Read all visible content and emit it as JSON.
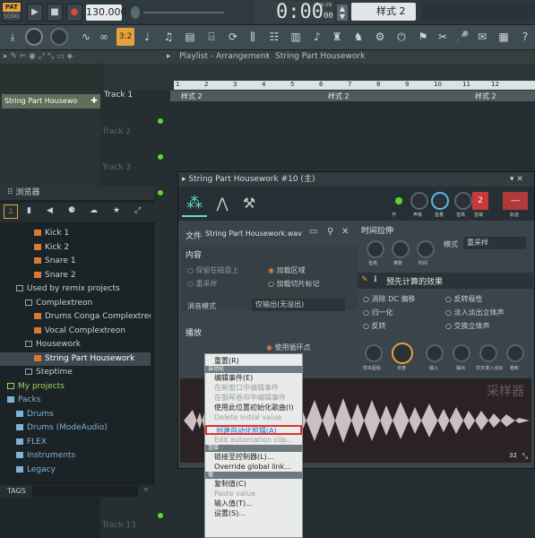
{
  "transport": {
    "pat_label": "PAT",
    "song_label": "SONG",
    "tempo": "130.000",
    "time": "0:00",
    "time_suffix": "00",
    "time_unit": "M:S:CS",
    "pattern": "样式 2"
  },
  "playlist": {
    "breadcrumb": "Playlist - Arrangement",
    "separator": "›",
    "title": "String Part Housework",
    "clip_name": "String Part Housewo",
    "tracks": [
      "Track 1",
      "Track 2",
      "Track 3",
      "Track 13"
    ],
    "ruler": [
      "1",
      "2",
      "3",
      "4",
      "5",
      "6",
      "7",
      "8",
      "9",
      "10",
      "11",
      "12"
    ],
    "pattern_blocks": [
      "样式 2",
      "样式 2",
      "样式 2",
      "样式 2"
    ]
  },
  "browser": {
    "title": "浏览器",
    "items": [
      "Kick 1",
      "Kick 2",
      "Snare 1",
      "Snare 2",
      "Used by remix projects",
      "Complextreon",
      "Drums Conga Complextreon",
      "Vocal Complextreon",
      "Housework",
      "String Part Housework",
      "Steptime",
      "My projects",
      "Packs",
      "Drums",
      "Drums (ModeAudio)",
      "FLEX",
      "Instruments",
      "Legacy"
    ],
    "tags_label": "TAGS"
  },
  "sampler": {
    "title": "String Part Housework #10 (主)",
    "file_label": "文件",
    "file_name": "String Part Housework.wav",
    "content_label": "内容",
    "opt_keep_disk": "保留在磁盘上",
    "opt_load_region": "加载区域",
    "opt_resample": "重采样",
    "opt_load_slices": "加载切片标记",
    "declick_label": "消音模式",
    "declick_value": "仅输出(无溢出)",
    "playback_label": "播放",
    "use_loop": "使用循环点",
    "stretch_label": "时间拉伸",
    "mode_label": "模式",
    "mode_value": "重采样",
    "stretch_knobs": [
      "音高",
      "乘数",
      "时间"
    ],
    "precomp_label": "预先计算的效果",
    "fx": [
      "消除 DC 偏移",
      "反转极性",
      "归一化",
      "淡入淡出立体声",
      "反转",
      "交换立体声"
    ],
    "fx_knobs": [
      "样本起始",
      "长度",
      "输入",
      "输出",
      "交叉淋入淡出",
      "卷积"
    ],
    "top_knobs": [
      "开",
      "声像",
      "音量",
      "音高",
      "音域",
      "轨道"
    ],
    "channel": "2",
    "track_btn": "---",
    "sampler_tag": "采样器",
    "counter": "32"
  },
  "menu": {
    "reset": "重置(R)",
    "sec_automate": "自动化",
    "edit_event": "编辑事件(E)",
    "edit_event_new": "在新窗口中编辑事件",
    "edit_in_piano": "在钢琴卷帘中编辑事件",
    "init_song": "使用此位置初始化歌曲(I)",
    "del_init": "Delete initial value",
    "create_clip": "创建自动化剪辑(A)",
    "edit_clip": "Edit automation clip...",
    "sec_link": "连接",
    "link_ctrl": "链接至控制器(L)...",
    "override": "Override global link...",
    "sec_value": "值",
    "copy": "复制值(C)",
    "paste": "Paste value",
    "enter": "输入值(T)...",
    "settings": "设置(S)..."
  },
  "colors": {
    "accent": "#e8a23a",
    "highlight": "#e03030",
    "led": "#5fd62a"
  }
}
